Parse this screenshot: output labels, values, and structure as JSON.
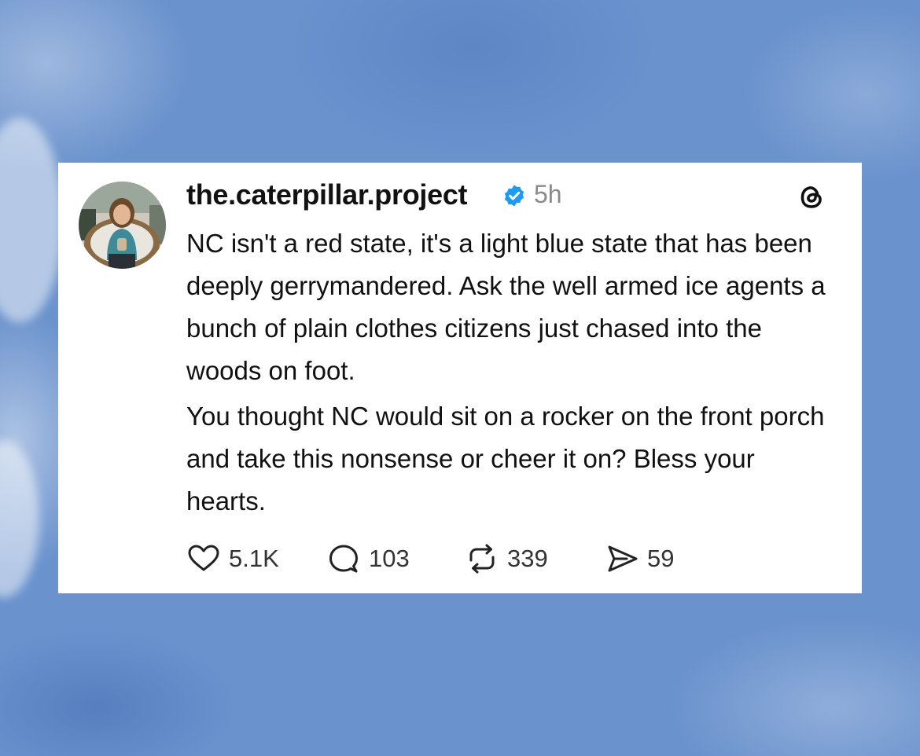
{
  "post": {
    "username": "the.caterpillar.project",
    "time": "5h",
    "paragraphs": [
      "NC isn't a red state, it's a light blue state that has been deeply gerrymandered. Ask the well armed ice agents a bunch of plain clothes citizens just chased into the woods on foot.",
      "You thought NC would sit on a rocker on the front porch and take this nonsense or cheer it on? Bless your hearts."
    ],
    "icons": {
      "avatar": "profile-photo",
      "verified": "verified-badge-icon",
      "app": "threads-logo-icon"
    }
  },
  "actions": {
    "likes": "5.1K",
    "replies": "103",
    "reposts": "339",
    "shares": "59"
  },
  "colors": {
    "background": "#6a92cd",
    "card": "#ffffff",
    "verified": "#1d9bf0",
    "text": "#111111",
    "muted": "#8a8a8a"
  }
}
